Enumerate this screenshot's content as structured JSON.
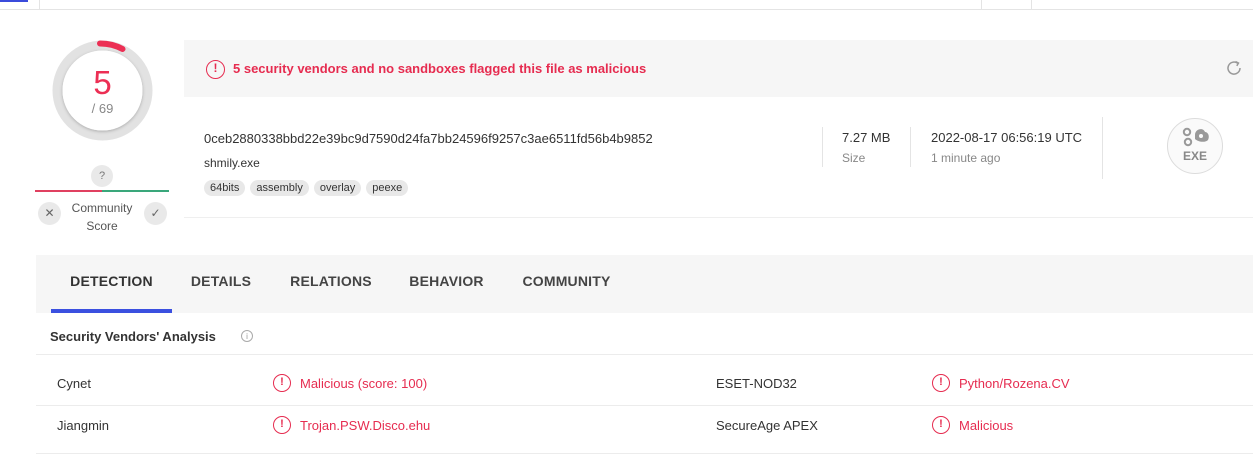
{
  "score": {
    "detections": "5",
    "total": "/ 69",
    "color": "#ec2f54"
  },
  "community": {
    "question": "?",
    "label_line1": "Community",
    "label_line2": "Score",
    "downvote": "✕",
    "upvote": "✓"
  },
  "alert": {
    "icon": "!",
    "message": "5 security vendors and no sandboxes flagged this file as malicious"
  },
  "file": {
    "hash": "0ceb2880338bbd22e39bc9d7590d24fa7bb24596f9257c3ae6511fd56b4b9852",
    "name": "shmily.exe",
    "tags": [
      "64bits",
      "assembly",
      "overlay",
      "peexe"
    ],
    "size_value": "7.27 MB",
    "size_label": "Size",
    "date_value": "2022-08-17 06:56:19 UTC",
    "date_label": "1 minute ago",
    "type_badge": "EXE"
  },
  "tabs": [
    {
      "label": "DETECTION",
      "active": true
    },
    {
      "label": "DETAILS",
      "active": false
    },
    {
      "label": "RELATIONS",
      "active": false
    },
    {
      "label": "BEHAVIOR",
      "active": false
    },
    {
      "label": "COMMUNITY",
      "active": false
    }
  ],
  "analysis": {
    "title": "Security Vendors' Analysis",
    "info_icon": "i",
    "rows": [
      {
        "vendor1": "Cynet",
        "result1": "Malicious (score: 100)",
        "vendor2": "ESET-NOD32",
        "result2": "Python/Rozena.CV"
      },
      {
        "vendor1": "Jiangmin",
        "result1": "Trojan.PSW.Disco.ehu",
        "vendor2": "SecureAge APEX",
        "result2": "Malicious"
      }
    ]
  },
  "colors": {
    "malicious": "#e62c50",
    "tab_active": "#3b50e0",
    "community_bad": "#e04060",
    "community_good": "#3aa77b"
  }
}
